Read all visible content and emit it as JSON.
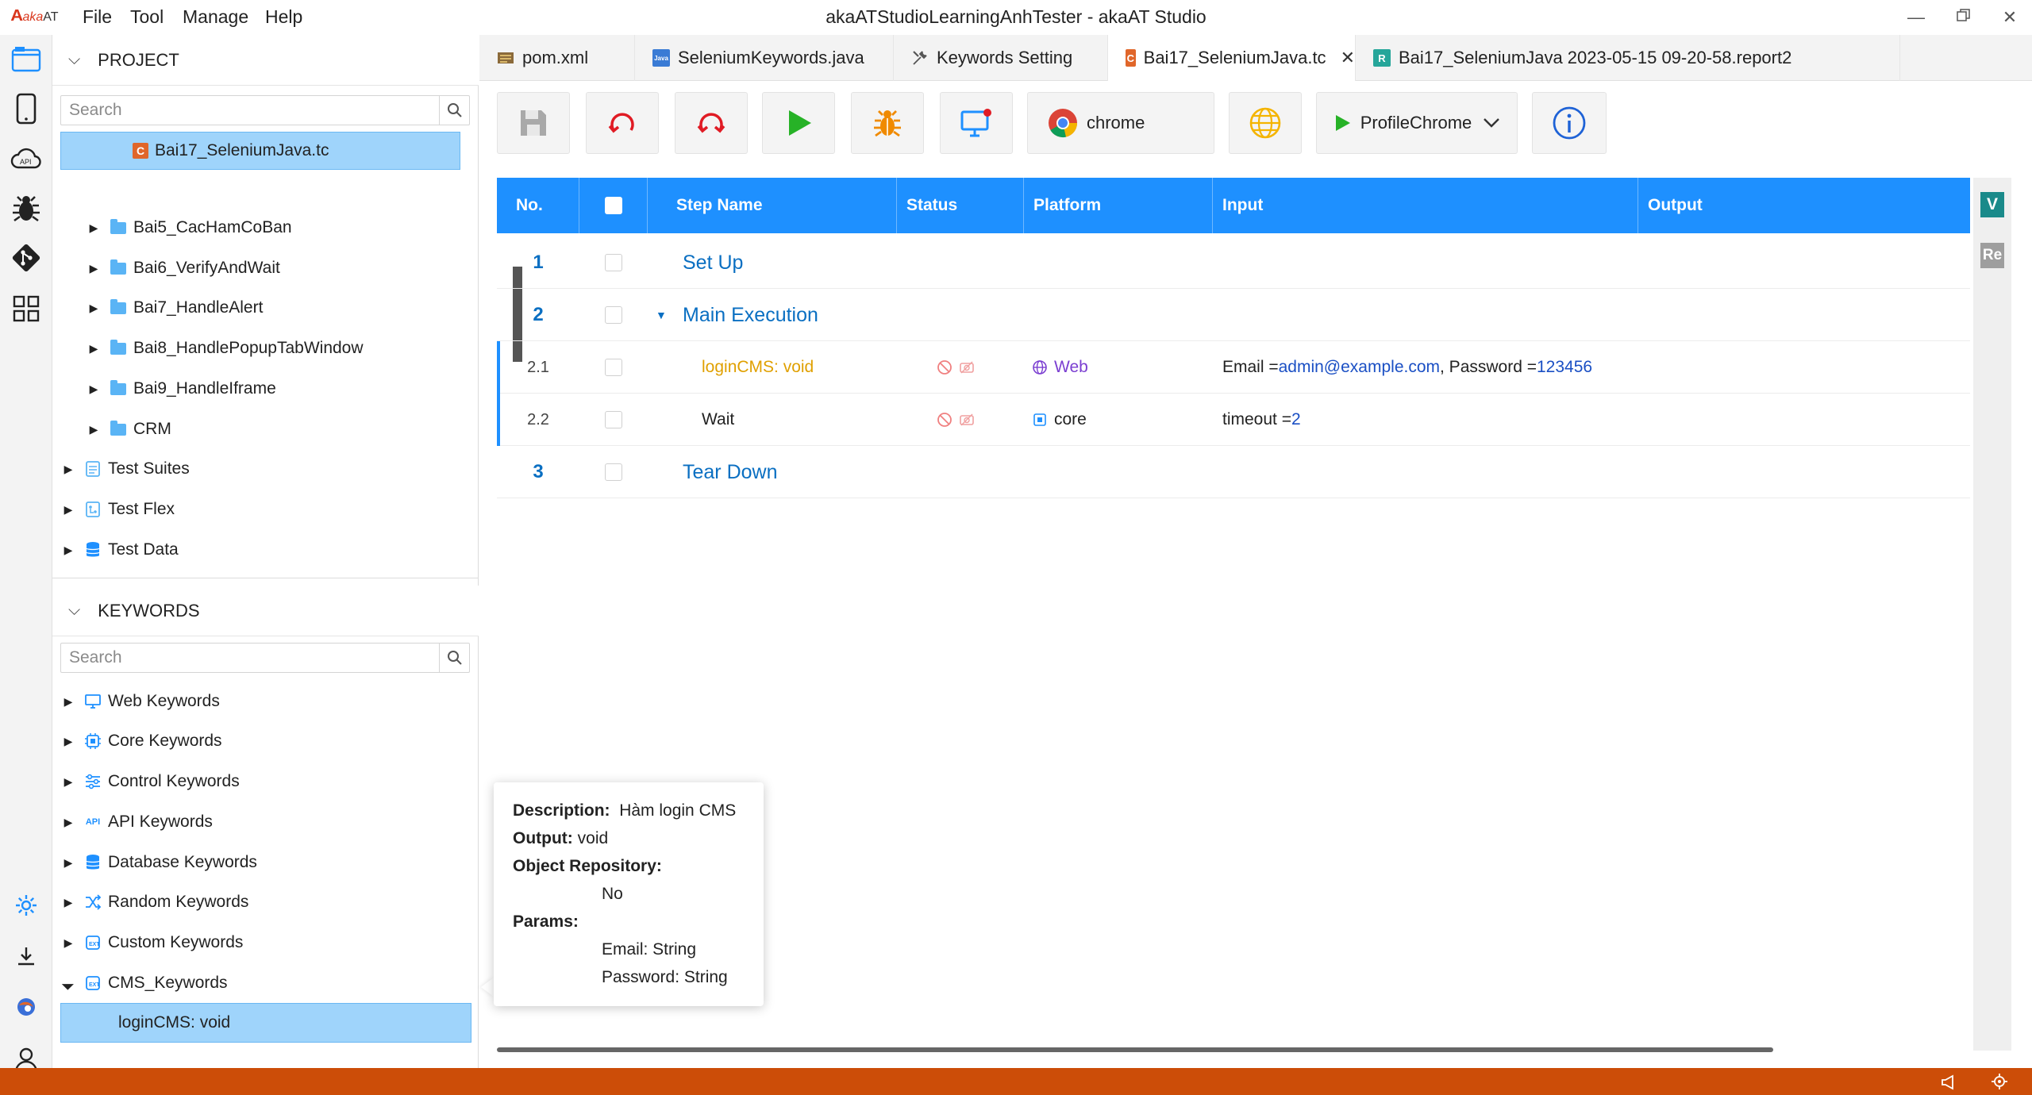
{
  "app": {
    "logo_text": "aka",
    "logo_sub": "AT",
    "window_title": "akaATStudioLearningAnhTester - akaAT Studio",
    "menu": [
      "File",
      "Tool",
      "Manage",
      "Help"
    ]
  },
  "project": {
    "header": "PROJECT",
    "search_placeholder": "Search",
    "items": [
      {
        "label": "Bai17_SeleniumJava.tc",
        "type": "testcase",
        "selected": true
      },
      {
        "label": "Bai5_CacHamCoBan",
        "type": "folder"
      },
      {
        "label": "Bai6_VerifyAndWait",
        "type": "folder"
      },
      {
        "label": "Bai7_HandleAlert",
        "type": "folder"
      },
      {
        "label": "Bai8_HandlePopupTabWindow",
        "type": "folder"
      },
      {
        "label": "Bai9_HandleIframe",
        "type": "folder"
      },
      {
        "label": "CRM",
        "type": "folder"
      },
      {
        "label": "Test Suites",
        "type": "suites"
      },
      {
        "label": "Test Flex",
        "type": "flex"
      },
      {
        "label": "Test Data",
        "type": "data"
      }
    ]
  },
  "keywords": {
    "header": "KEYWORDS",
    "search_placeholder": "Search",
    "items": [
      {
        "label": "Web Keywords",
        "icon": "monitor-icon"
      },
      {
        "label": "Core Keywords",
        "icon": "chip-icon"
      },
      {
        "label": "Control Keywords",
        "icon": "sliders-icon"
      },
      {
        "label": "API Keywords",
        "icon": "api-icon"
      },
      {
        "label": "Database Keywords",
        "icon": "database-icon"
      },
      {
        "label": "Random Keywords",
        "icon": "shuffle-icon"
      },
      {
        "label": "Custom Keywords",
        "icon": "custom-icon"
      },
      {
        "label": "CMS_Keywords",
        "icon": "custom-icon"
      }
    ],
    "child": "loginCMS: void"
  },
  "tabs": [
    {
      "label": "pom.xml",
      "icon": "xml-icon",
      "color": "#7a5b2e"
    },
    {
      "label": "SeleniumKeywords.java",
      "icon": "java-icon",
      "color": "#3a7bd5"
    },
    {
      "label": "Keywords Setting",
      "icon": "tools-icon",
      "color": "#555555"
    },
    {
      "label": "Bai17_SeleniumJava.tc",
      "icon": "testcase-icon",
      "color": "#e0662a",
      "active": true,
      "close": "✕"
    },
    {
      "label": "Bai17_SeleniumJava 2023-05-15 09-20-58.report2",
      "icon": "report-icon",
      "color": "#26a69a",
      "badge": "R"
    }
  ],
  "toolbar": {
    "browser": "chrome",
    "profile": "ProfileChrome"
  },
  "table": {
    "columns": [
      "No.",
      "",
      "Step Name",
      "Status",
      "Platform",
      "Input",
      "Output"
    ],
    "rows": [
      {
        "no": "1",
        "name": "Set Up",
        "kind": "section"
      },
      {
        "no": "2",
        "name": "Main Execution",
        "kind": "section",
        "expanded": true
      },
      {
        "no": "2.1",
        "name": "loginCMS: void",
        "kind": "step",
        "platform": "Web",
        "input_parts": [
          [
            "Email = ",
            "k"
          ],
          [
            "admin@example.com",
            "v"
          ],
          [
            ", Password = ",
            "k"
          ],
          [
            "123456",
            "v"
          ]
        ]
      },
      {
        "no": "2.2",
        "name": "Wait",
        "kind": "step",
        "platform": "core",
        "input_parts": [
          [
            "timeout = ",
            "k"
          ],
          [
            "2",
            "v"
          ]
        ]
      },
      {
        "no": "3",
        "name": "Tear Down",
        "kind": "section"
      }
    ]
  },
  "tooltip": {
    "description_label": "Description:",
    "description": "Hàm login CMS",
    "output_label": "Output:",
    "output": "void",
    "repo_label": "Object Repository:",
    "repo": "No",
    "params_label": "Params:",
    "params": [
      "Email: String",
      "Password: String"
    ]
  },
  "right_badges": [
    {
      "text": "V",
      "color": "#1a8a8a"
    },
    {
      "text": "Re",
      "color": "#9e9e9e"
    }
  ],
  "colors": {
    "accent": "#1e90ff",
    "status_bar": "#cc4d08",
    "keyword_step": "#e0a000",
    "link_blue": "#0a6fc2"
  }
}
